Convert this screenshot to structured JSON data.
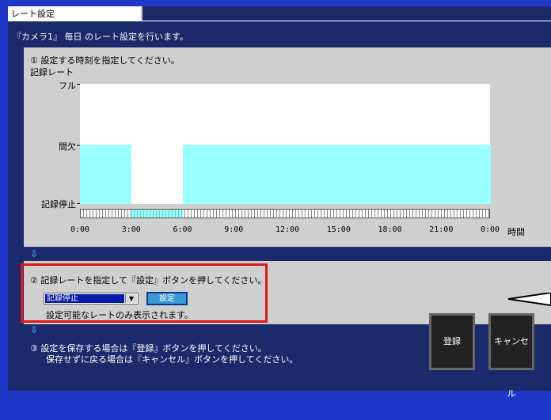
{
  "window": {
    "title": "レート設定",
    "subtitle": "『カメラ1』 毎日 のレート設定を行います。"
  },
  "step1": {
    "instruction": "① 設定する時刻を指定してください。",
    "ylabel": "記録レート"
  },
  "chart_data": {
    "type": "area",
    "ylabel": "記録レート",
    "xlabel": "時間",
    "y_levels": [
      "フル",
      "間欠",
      "記録停止"
    ],
    "x_ticks": [
      "0:00",
      "3:00",
      "6:00",
      "9:00",
      "12:00",
      "15:00",
      "18:00",
      "21:00",
      "0:00"
    ],
    "segments": [
      {
        "start_hour": 0,
        "end_hour": 3,
        "rate": "間欠"
      },
      {
        "start_hour": 3,
        "end_hour": 6,
        "rate": "記録停止"
      },
      {
        "start_hour": 6,
        "end_hour": 24,
        "rate": "間欠"
      }
    ],
    "selection": {
      "start_hour": 3,
      "end_hour": 6
    }
  },
  "step2": {
    "instruction": "② 記録レートを指定して『設定』ボタンを押してください。",
    "select_value": "記録停止",
    "set_label": "設定",
    "note": "設定可能なレートのみ表示されます。"
  },
  "step3": {
    "line1": "③ 設定を保存する場合は『登録』ボタンを押してください。",
    "line2": "保存せずに戻る場合は『キャンセル』ボタンを押してください。"
  },
  "buttons": {
    "register": "登録",
    "cancel": "キャンセル"
  },
  "colors": {
    "accent": "#99ffff",
    "highlight": "#e01818",
    "background": "#2038c8"
  }
}
